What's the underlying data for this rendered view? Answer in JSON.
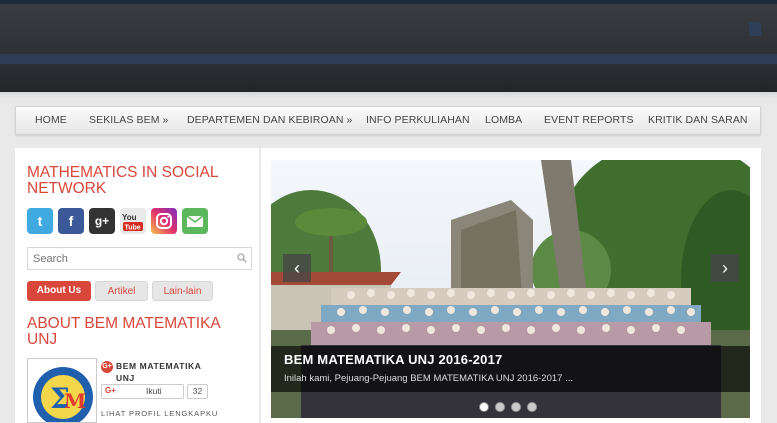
{
  "nav": {
    "items": [
      {
        "label": "HOME"
      },
      {
        "label": "SEKILAS BEM »"
      },
      {
        "label": "DEPARTEMEN DAN KEBIROAN »"
      },
      {
        "label": "INFO PERKULIAHAN"
      },
      {
        "label": "LOMBA"
      },
      {
        "label": "EVENT REPORTS"
      },
      {
        "label": "KRITIK DAN SARAN"
      }
    ]
  },
  "sidebar": {
    "social_title": "MATHEMATICS IN SOCIAL NETWORK",
    "social_icons": [
      {
        "icon": "twitter-icon",
        "glyph": "t",
        "color": "#3fa9e0"
      },
      {
        "icon": "facebook-icon",
        "glyph": "f",
        "color": "#3b5998"
      },
      {
        "icon": "google-plus-icon",
        "glyph": "g+",
        "color": "#333333"
      },
      {
        "icon": "youtube-icon",
        "glyph": "You",
        "color": "#e0e0e0"
      },
      {
        "icon": "instagram-icon",
        "glyph": "◎",
        "color": "#c13584"
      },
      {
        "icon": "email-icon",
        "glyph": "✉",
        "color": "#5cb85c"
      }
    ],
    "search": {
      "placeholder": "Search"
    },
    "tabs": [
      {
        "label": "About Us",
        "active": true
      },
      {
        "label": "Artikel",
        "active": false
      },
      {
        "label": "Lain-lain",
        "active": false
      }
    ],
    "about_title": "ABOUT BEM MATEMATIKA UNJ",
    "profile": {
      "name_line1": "BEM MATEMATIKA",
      "name_line2": "UNJ",
      "follow_label": "Ikuti",
      "follow_count": "32",
      "link_label": "LIHAT PROFIL LENGKAPKU"
    }
  },
  "slider": {
    "title": "BEM MATEMATIKA UNJ 2016-2017",
    "text": "Inilah kami, Pejuang-Pejuang BEM MATEMATIKA UNJ 2016-2017 ...",
    "prev_glyph": "‹",
    "next_glyph": "›",
    "slide_count": 4,
    "active_slide": 1
  },
  "colors": {
    "accent": "#d9473b",
    "header": "#2d3035"
  }
}
